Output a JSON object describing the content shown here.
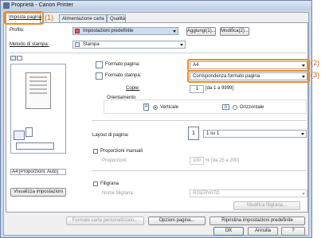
{
  "window": {
    "title": "Proprietà - Canon Printer"
  },
  "tabs": [
    {
      "label": "Imposta pagina",
      "active": true
    },
    {
      "label": "Alimentazione carta",
      "active": false
    },
    {
      "label": "Qualità",
      "active": false
    }
  ],
  "callouts": {
    "c1": "(1)",
    "c2": "(2)",
    "c3": "(3)"
  },
  "profile": {
    "label": "Profilo:",
    "value": "Impostazioni predefinite",
    "add_button": "Aggiungi(1)...",
    "edit_button": "Modifica(2)..."
  },
  "output_method": {
    "label": "Metodo di stampa:",
    "value": "Stampa"
  },
  "preview": {
    "caption": "A4 [Proporzioni: Auto]"
  },
  "view_settings_button": "Visualizza impostazioni",
  "page_size": {
    "label": "Formato pagina:",
    "value": "A4"
  },
  "output_size": {
    "label": "Formato stampa:",
    "value": "Corrispondenza formato pagina"
  },
  "copies": {
    "label": "Copie:",
    "value": "1",
    "range": "[da 1 a 9999]"
  },
  "orientation": {
    "label": "Orientamento",
    "portrait": "Verticale",
    "landscape": "Orizzontale",
    "selected": "portrait"
  },
  "page_layout": {
    "label": "Layout di pagina:",
    "value": "1 su 1",
    "icon_number": "1"
  },
  "manual_scaling": {
    "label": "Proporzioni manuali",
    "sub_label": "Proporzioni:",
    "value": "100",
    "range": "% [da 25 a 200]"
  },
  "watermark": {
    "label": "Filigrana",
    "name_label": "Nome filigrana:",
    "value": "RISERVATO",
    "edit_button": "Modifica filigrana..."
  },
  "bottom_buttons": {
    "custom_paper": "Formato carta personalizzato...",
    "page_options": "Opzioni pagina...",
    "restore_defaults": "Ripristina impostazioni predefinite"
  },
  "dialog_buttons": {
    "ok": "OK",
    "cancel": "Annulla",
    "help": "?"
  },
  "colors": {
    "highlight": "#f08a1c",
    "callout_text": "#d2690e"
  }
}
